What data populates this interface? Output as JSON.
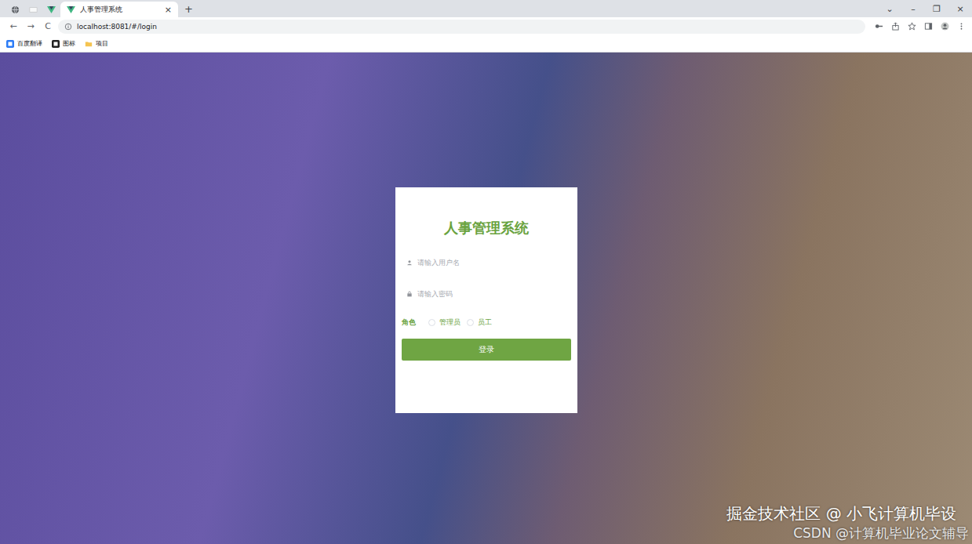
{
  "browser": {
    "tabs": [
      {
        "title": "",
        "selected": false,
        "kind": "globe"
      },
      {
        "title": "",
        "selected": false,
        "kind": "blank"
      },
      {
        "title": "",
        "selected": false,
        "kind": "vue"
      },
      {
        "title": "人事管理系统",
        "selected": true,
        "kind": "vue"
      }
    ],
    "tab_close": "×",
    "new_tab": "+",
    "window_controls": [
      "⌄",
      "–",
      "❐",
      "×"
    ],
    "nav": [
      "←",
      "→",
      "C"
    ],
    "address": "localhost:8081/#/login",
    "bookmarks": [
      {
        "label": "百度翻译",
        "kind": "translate"
      },
      {
        "label": "图标",
        "kind": "icon"
      },
      {
        "label": "项目",
        "kind": "folder"
      }
    ]
  },
  "login": {
    "title": "人事管理系统",
    "username_placeholder": "请输入用户名",
    "password_placeholder": "请输入密码",
    "role_label": "角色",
    "roles": [
      {
        "label": "管理员",
        "selected": false
      },
      {
        "label": "员工",
        "selected": false
      }
    ],
    "button": "登录"
  },
  "watermark": [
    "掘金技术社区 @ 小飞计算机毕设",
    "CSDN @计算机毕业论文辅导"
  ]
}
